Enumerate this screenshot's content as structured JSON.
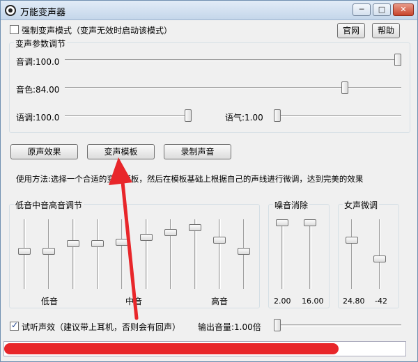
{
  "window": {
    "title": "万能变声器",
    "minimize": "─",
    "maximize": "□",
    "close": "✕"
  },
  "top": {
    "force_mode_label": "强制变声模式（变声无效时启动该模式）",
    "force_mode_checked": false,
    "website_button": "官网",
    "help_button": "帮助"
  },
  "voice_params": {
    "legend": "变声参数调节",
    "pitch_label": "音调:100.0",
    "pitch_value": 1.0,
    "timbre_label": "音色:84.00",
    "timbre_value": 0.84,
    "speed_label": "语调:100.0",
    "speed_value": 1.0,
    "tone_label": "语气:1.00",
    "tone_value": 0.0
  },
  "actions": {
    "original_button": "原声效果",
    "template_button": "变声模板",
    "record_button": "录制声音"
  },
  "usage_text": "使用方法:选择一个合适的变声模板，然后在模板基础上根据自己的声线进行微调，达到完美的效果",
  "equalizer": {
    "legend": "低音中音高音调节",
    "bands": [
      0.54,
      0.54,
      0.67,
      0.67,
      0.69,
      0.77,
      0.84,
      0.92,
      0.72,
      0.54
    ],
    "low_label": "低音",
    "mid_label": "中音",
    "high_label": "高音"
  },
  "noise": {
    "legend": "噪音消除",
    "sliders": [
      1.0,
      1.0
    ],
    "value1": "2.00",
    "value2": "16.00"
  },
  "female": {
    "legend": "女声微调",
    "sliders": [
      0.72,
      0.42
    ],
    "value1": "24.80",
    "value2": "-42"
  },
  "bottom": {
    "listen_label": "试听声效（建议带上耳机，否则会有回声）",
    "listen_checked": true,
    "output_volume_label": "输出音量:1.00倍",
    "output_volume_value": 0.0
  },
  "colors": {
    "annotation_red": "#e8262a"
  }
}
